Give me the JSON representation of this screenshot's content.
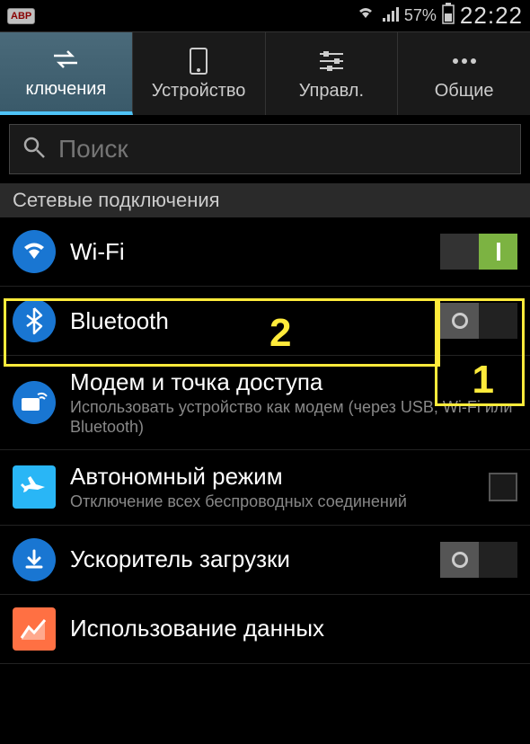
{
  "status": {
    "abp": "ABP",
    "battery_pct": "57%",
    "time": "22:22"
  },
  "tabs": {
    "connections": "ключения",
    "device": "Устройство",
    "controls": "Управл.",
    "general": "Общие"
  },
  "search": {
    "placeholder": "Поиск"
  },
  "section": "Сетевые подключения",
  "items": {
    "wifi": {
      "title": "Wi-Fi"
    },
    "bluetooth": {
      "title": "Bluetooth"
    },
    "tether": {
      "title": "Модем и точка доступа",
      "subtitle": "Использовать устройство как модем (через USB, Wi-Fi или Bluetooth)"
    },
    "airplane": {
      "title": "Автономный режим",
      "subtitle": "Отключение всех беспроводных соединений"
    },
    "booster": {
      "title": "Ускоритель загрузки"
    },
    "datausage": {
      "title": "Использование данных"
    }
  },
  "annotations": {
    "one": "1",
    "two": "2"
  }
}
